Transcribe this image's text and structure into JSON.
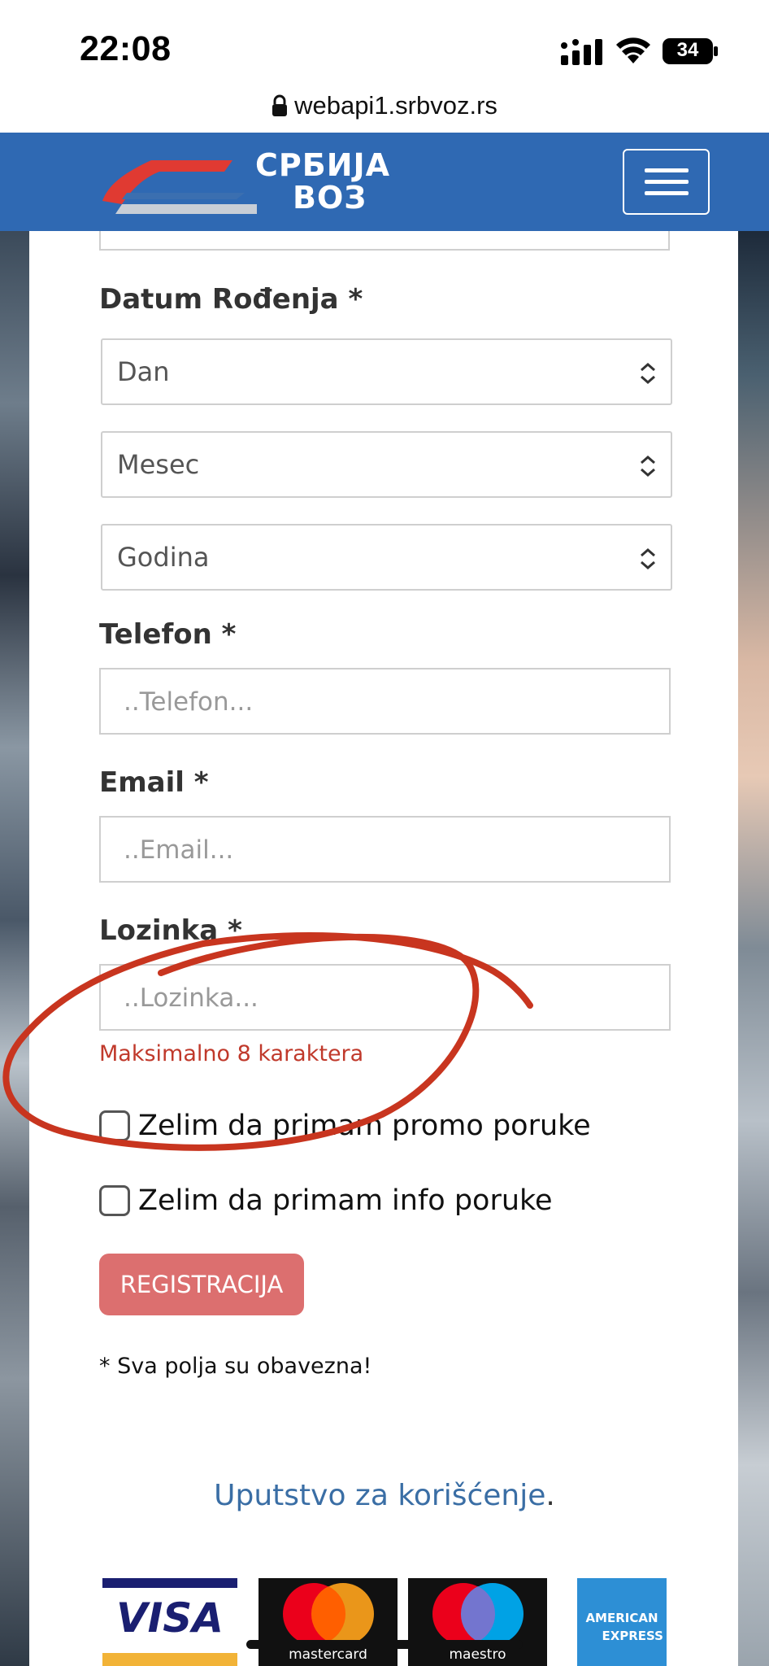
{
  "status_bar": {
    "time": "22:08",
    "battery": "34"
  },
  "browser": {
    "url": "webapi1.srbvoz.rs"
  },
  "header": {
    "logo_line1": "СРБИЈА",
    "logo_line2": "ВОЗ"
  },
  "form": {
    "birth_date": {
      "label": "Datum Rođenja *",
      "day": "Dan",
      "month": "Mesec",
      "year": "Godina"
    },
    "phone": {
      "label": "Telefon *",
      "placeholder": "..Telefon..."
    },
    "email": {
      "label": "Email *",
      "placeholder": "..Email..."
    },
    "password": {
      "label": "Lozinka *",
      "placeholder": "..Lozinka...",
      "hint": "Maksimalno 8 karaktera"
    },
    "promo_checkbox": "Zelim da primam promo poruke",
    "info_checkbox": "Zelim da primam info poruke",
    "submit": "REGISTRACIJA",
    "required_note": "* Sva polja su obavezna!"
  },
  "help": {
    "link": "Uputstvo za korišćenje",
    "suffix": "."
  },
  "payment": {
    "visa": "VISA",
    "mastercard": "mastercard",
    "maestro": "maestro",
    "amex_line1": "AMERICAN",
    "amex_line2": "EXPRESS"
  },
  "colors": {
    "header_blue": "#2f69b3",
    "button_red": "#dc6f6f",
    "hint_red": "#c0392b",
    "link_blue": "#3a6ea5",
    "annotation_red": "#c8351f"
  }
}
